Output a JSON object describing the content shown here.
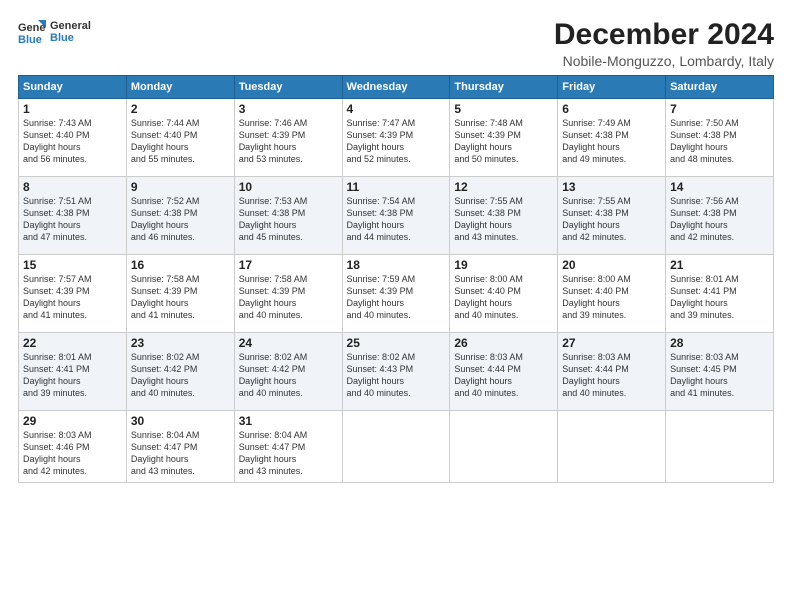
{
  "header": {
    "logo_line1": "General",
    "logo_line2": "Blue",
    "month": "December 2024",
    "location": "Nobile-Monguzzo, Lombardy, Italy"
  },
  "weekdays": [
    "Sunday",
    "Monday",
    "Tuesday",
    "Wednesday",
    "Thursday",
    "Friday",
    "Saturday"
  ],
  "weeks": [
    [
      {
        "day": "1",
        "sunrise": "7:43 AM",
        "sunset": "4:40 PM",
        "daylight": "8 hours and 56 minutes."
      },
      {
        "day": "2",
        "sunrise": "7:44 AM",
        "sunset": "4:40 PM",
        "daylight": "8 hours and 55 minutes."
      },
      {
        "day": "3",
        "sunrise": "7:46 AM",
        "sunset": "4:39 PM",
        "daylight": "8 hours and 53 minutes."
      },
      {
        "day": "4",
        "sunrise": "7:47 AM",
        "sunset": "4:39 PM",
        "daylight": "8 hours and 52 minutes."
      },
      {
        "day": "5",
        "sunrise": "7:48 AM",
        "sunset": "4:39 PM",
        "daylight": "8 hours and 50 minutes."
      },
      {
        "day": "6",
        "sunrise": "7:49 AM",
        "sunset": "4:38 PM",
        "daylight": "8 hours and 49 minutes."
      },
      {
        "day": "7",
        "sunrise": "7:50 AM",
        "sunset": "4:38 PM",
        "daylight": "8 hours and 48 minutes."
      }
    ],
    [
      {
        "day": "8",
        "sunrise": "7:51 AM",
        "sunset": "4:38 PM",
        "daylight": "8 hours and 47 minutes."
      },
      {
        "day": "9",
        "sunrise": "7:52 AM",
        "sunset": "4:38 PM",
        "daylight": "8 hours and 46 minutes."
      },
      {
        "day": "10",
        "sunrise": "7:53 AM",
        "sunset": "4:38 PM",
        "daylight": "8 hours and 45 minutes."
      },
      {
        "day": "11",
        "sunrise": "7:54 AM",
        "sunset": "4:38 PM",
        "daylight": "8 hours and 44 minutes."
      },
      {
        "day": "12",
        "sunrise": "7:55 AM",
        "sunset": "4:38 PM",
        "daylight": "8 hours and 43 minutes."
      },
      {
        "day": "13",
        "sunrise": "7:55 AM",
        "sunset": "4:38 PM",
        "daylight": "8 hours and 42 minutes."
      },
      {
        "day": "14",
        "sunrise": "7:56 AM",
        "sunset": "4:38 PM",
        "daylight": "8 hours and 42 minutes."
      }
    ],
    [
      {
        "day": "15",
        "sunrise": "7:57 AM",
        "sunset": "4:39 PM",
        "daylight": "8 hours and 41 minutes."
      },
      {
        "day": "16",
        "sunrise": "7:58 AM",
        "sunset": "4:39 PM",
        "daylight": "8 hours and 41 minutes."
      },
      {
        "day": "17",
        "sunrise": "7:58 AM",
        "sunset": "4:39 PM",
        "daylight": "8 hours and 40 minutes."
      },
      {
        "day": "18",
        "sunrise": "7:59 AM",
        "sunset": "4:39 PM",
        "daylight": "8 hours and 40 minutes."
      },
      {
        "day": "19",
        "sunrise": "8:00 AM",
        "sunset": "4:40 PM",
        "daylight": "8 hours and 40 minutes."
      },
      {
        "day": "20",
        "sunrise": "8:00 AM",
        "sunset": "4:40 PM",
        "daylight": "8 hours and 39 minutes."
      },
      {
        "day": "21",
        "sunrise": "8:01 AM",
        "sunset": "4:41 PM",
        "daylight": "8 hours and 39 minutes."
      }
    ],
    [
      {
        "day": "22",
        "sunrise": "8:01 AM",
        "sunset": "4:41 PM",
        "daylight": "8 hours and 39 minutes."
      },
      {
        "day": "23",
        "sunrise": "8:02 AM",
        "sunset": "4:42 PM",
        "daylight": "8 hours and 40 minutes."
      },
      {
        "day": "24",
        "sunrise": "8:02 AM",
        "sunset": "4:42 PM",
        "daylight": "8 hours and 40 minutes."
      },
      {
        "day": "25",
        "sunrise": "8:02 AM",
        "sunset": "4:43 PM",
        "daylight": "8 hours and 40 minutes."
      },
      {
        "day": "26",
        "sunrise": "8:03 AM",
        "sunset": "4:44 PM",
        "daylight": "8 hours and 40 minutes."
      },
      {
        "day": "27",
        "sunrise": "8:03 AM",
        "sunset": "4:44 PM",
        "daylight": "8 hours and 40 minutes."
      },
      {
        "day": "28",
        "sunrise": "8:03 AM",
        "sunset": "4:45 PM",
        "daylight": "8 hours and 41 minutes."
      }
    ],
    [
      {
        "day": "29",
        "sunrise": "8:03 AM",
        "sunset": "4:46 PM",
        "daylight": "8 hours and 42 minutes."
      },
      {
        "day": "30",
        "sunrise": "8:04 AM",
        "sunset": "4:47 PM",
        "daylight": "8 hours and 43 minutes."
      },
      {
        "day": "31",
        "sunrise": "8:04 AM",
        "sunset": "4:47 PM",
        "daylight": "8 hours and 43 minutes."
      },
      null,
      null,
      null,
      null
    ]
  ]
}
